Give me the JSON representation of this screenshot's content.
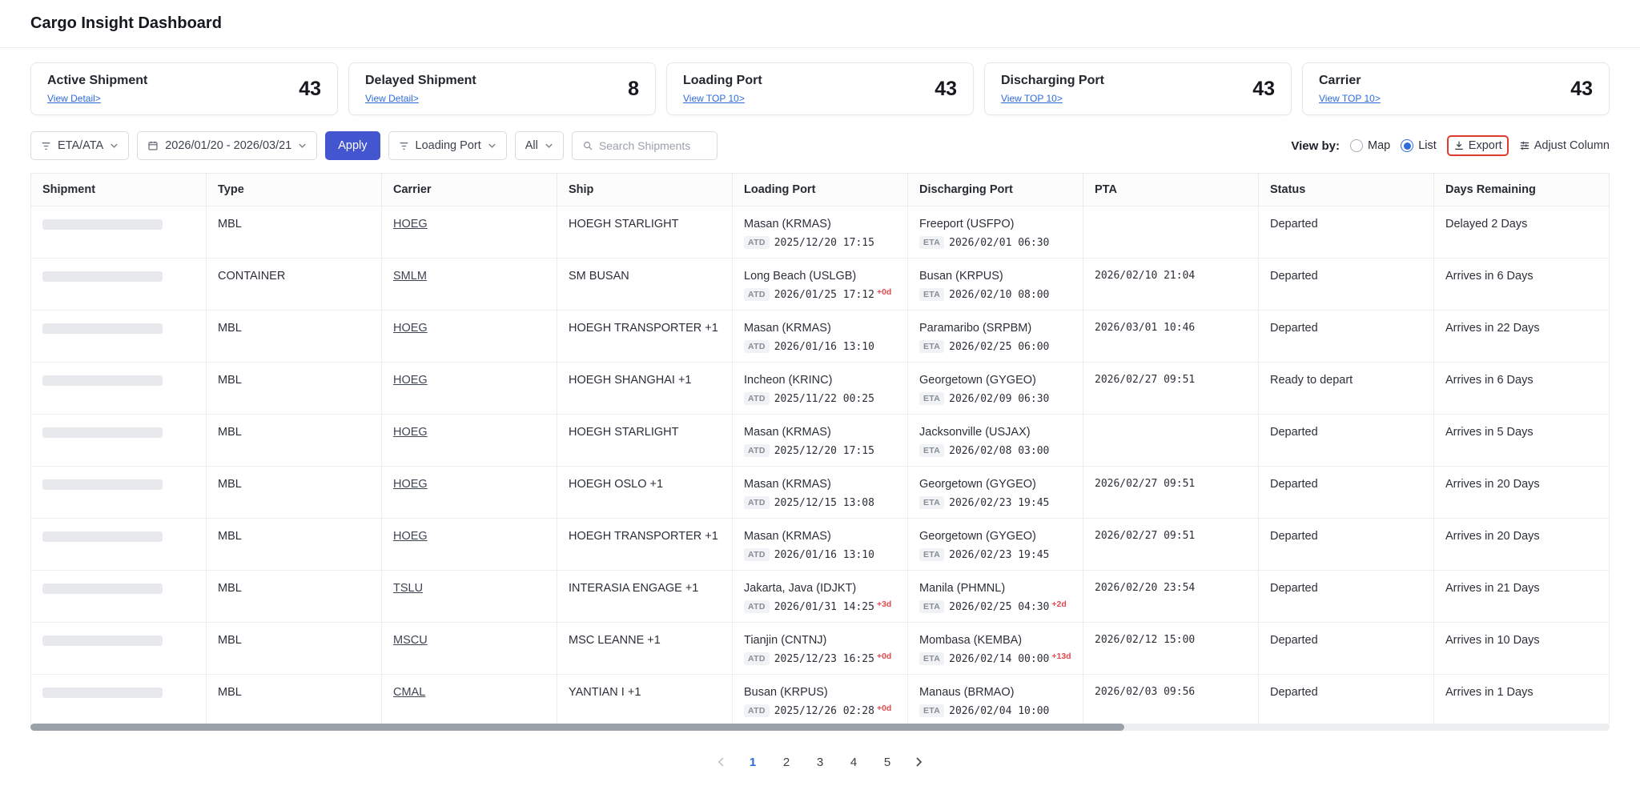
{
  "header": {
    "title": "Cargo Insight Dashboard"
  },
  "colors": {
    "accent": "#2e6bdb",
    "apply": "#4356cf",
    "danger": "#e5484d",
    "highlight": "#e23a2e"
  },
  "summary_cards": [
    {
      "label": "Active Shipment",
      "link": "View Detail>",
      "value": "43"
    },
    {
      "label": "Delayed Shipment",
      "link": "View Detail>",
      "value": "8"
    },
    {
      "label": "Loading Port",
      "link": "View TOP 10>",
      "value": "43"
    },
    {
      "label": "Discharging Port",
      "link": "View TOP 10>",
      "value": "43"
    },
    {
      "label": "Carrier",
      "link": "View TOP 10>",
      "value": "43"
    }
  ],
  "filters": {
    "eta_ata": "ETA/ATA",
    "date_range": "2026/01/20 - 2026/03/21",
    "apply": "Apply",
    "loading_port": "Loading Port",
    "all": "All",
    "search_placeholder": "Search Shipments",
    "view_by": "View by:",
    "map": "Map",
    "list": "List",
    "export": "Export",
    "adjust_column": "Adjust Column"
  },
  "icons": {
    "filter": "funnel-lines",
    "calendar": "calendar",
    "search": "magnifier",
    "export": "download-arrow",
    "adjust_column": "sliders",
    "chevron": "chevron-down"
  },
  "table": {
    "columns": [
      "Shipment",
      "Type",
      "Carrier",
      "Ship",
      "Loading Port",
      "Discharging Port",
      "PTA",
      "Status",
      "Days Remaining"
    ],
    "rows": [
      {
        "type": "MBL",
        "carrier": "HOEG",
        "ship": "HOEGH STARLIGHT",
        "loading": {
          "port": "Masan (KRMAS)",
          "badge": "ATD",
          "datetime": "2025/12/20 17:15",
          "delay": ""
        },
        "discharging": {
          "port": "Freeport (USFPO)",
          "badge": "ETA",
          "datetime": "2026/02/01 06:30",
          "delay": ""
        },
        "pta": "",
        "status": "Departed",
        "days": "Delayed 2 Days"
      },
      {
        "type": "CONTAINER",
        "carrier": "SMLM",
        "ship": "SM BUSAN",
        "loading": {
          "port": "Long Beach (USLGB)",
          "badge": "ATD",
          "datetime": "2026/01/25 17:12",
          "delay": "+0d"
        },
        "discharging": {
          "port": "Busan (KRPUS)",
          "badge": "ETA",
          "datetime": "2026/02/10 08:00",
          "delay": ""
        },
        "pta": "2026/02/10 21:04",
        "status": "Departed",
        "days": "Arrives in 6 Days"
      },
      {
        "type": "MBL",
        "carrier": "HOEG",
        "ship": "HOEGH TRANSPORTER +1",
        "loading": {
          "port": "Masan (KRMAS)",
          "badge": "ATD",
          "datetime": "2026/01/16 13:10",
          "delay": ""
        },
        "discharging": {
          "port": "Paramaribo (SRPBM)",
          "badge": "ETA",
          "datetime": "2026/02/25 06:00",
          "delay": ""
        },
        "pta": "2026/03/01 10:46",
        "status": "Departed",
        "days": "Arrives in 22 Days"
      },
      {
        "type": "MBL",
        "carrier": "HOEG",
        "ship": "HOEGH SHANGHAI +1",
        "loading": {
          "port": "Incheon (KRINC)",
          "badge": "ATD",
          "datetime": "2025/11/22 00:25",
          "delay": ""
        },
        "discharging": {
          "port": "Georgetown (GYGEO)",
          "badge": "ETA",
          "datetime": "2026/02/09 06:30",
          "delay": ""
        },
        "pta": "2026/02/27 09:51",
        "status": "Ready to depart",
        "days": "Arrives in 6 Days"
      },
      {
        "type": "MBL",
        "carrier": "HOEG",
        "ship": "HOEGH STARLIGHT",
        "loading": {
          "port": "Masan (KRMAS)",
          "badge": "ATD",
          "datetime": "2025/12/20 17:15",
          "delay": ""
        },
        "discharging": {
          "port": "Jacksonville (USJAX)",
          "badge": "ETA",
          "datetime": "2026/02/08 03:00",
          "delay": ""
        },
        "pta": "",
        "status": "Departed",
        "days": "Arrives in 5 Days"
      },
      {
        "type": "MBL",
        "carrier": "HOEG",
        "ship": "HOEGH OSLO +1",
        "loading": {
          "port": "Masan (KRMAS)",
          "badge": "ATD",
          "datetime": "2025/12/15 13:08",
          "delay": ""
        },
        "discharging": {
          "port": "Georgetown (GYGEO)",
          "badge": "ETA",
          "datetime": "2026/02/23 19:45",
          "delay": ""
        },
        "pta": "2026/02/27 09:51",
        "status": "Departed",
        "days": "Arrives in 20 Days"
      },
      {
        "type": "MBL",
        "carrier": "HOEG",
        "ship": "HOEGH TRANSPORTER +1",
        "loading": {
          "port": "Masan (KRMAS)",
          "badge": "ATD",
          "datetime": "2026/01/16 13:10",
          "delay": ""
        },
        "discharging": {
          "port": "Georgetown (GYGEO)",
          "badge": "ETA",
          "datetime": "2026/02/23 19:45",
          "delay": ""
        },
        "pta": "2026/02/27 09:51",
        "status": "Departed",
        "days": "Arrives in 20 Days"
      },
      {
        "type": "MBL",
        "carrier": "TSLU",
        "ship": "INTERASIA ENGAGE +1",
        "loading": {
          "port": "Jakarta, Java (IDJKT)",
          "badge": "ATD",
          "datetime": "2026/01/31 14:25",
          "delay": "+3d"
        },
        "discharging": {
          "port": "Manila (PHMNL)",
          "badge": "ETA",
          "datetime": "2026/02/25 04:30",
          "delay": "+2d"
        },
        "pta": "2026/02/20 23:54",
        "status": "Departed",
        "days": "Arrives in 21 Days"
      },
      {
        "type": "MBL",
        "carrier": "MSCU",
        "ship": "MSC LEANNE +1",
        "loading": {
          "port": "Tianjin (CNTNJ)",
          "badge": "ATD",
          "datetime": "2025/12/23 16:25",
          "delay": "+0d"
        },
        "discharging": {
          "port": "Mombasa (KEMBA)",
          "badge": "ETA",
          "datetime": "2026/02/14 00:00",
          "delay": "+13d"
        },
        "pta": "2026/02/12 15:00",
        "status": "Departed",
        "days": "Arrives in 10 Days"
      },
      {
        "type": "MBL",
        "carrier": "CMAL",
        "ship": "YANTIAN I +1",
        "loading": {
          "port": "Busan (KRPUS)",
          "badge": "ATD",
          "datetime": "2025/12/26 02:28",
          "delay": "+0d"
        },
        "discharging": {
          "port": "Manaus (BRMAO)",
          "badge": "ETA",
          "datetime": "2026/02/04 10:00",
          "delay": ""
        },
        "pta": "2026/02/03 09:56",
        "status": "Departed",
        "days": "Arrives in 1 Days"
      }
    ]
  },
  "pagination": {
    "pages": [
      "1",
      "2",
      "3",
      "4",
      "5"
    ],
    "active": "1"
  }
}
